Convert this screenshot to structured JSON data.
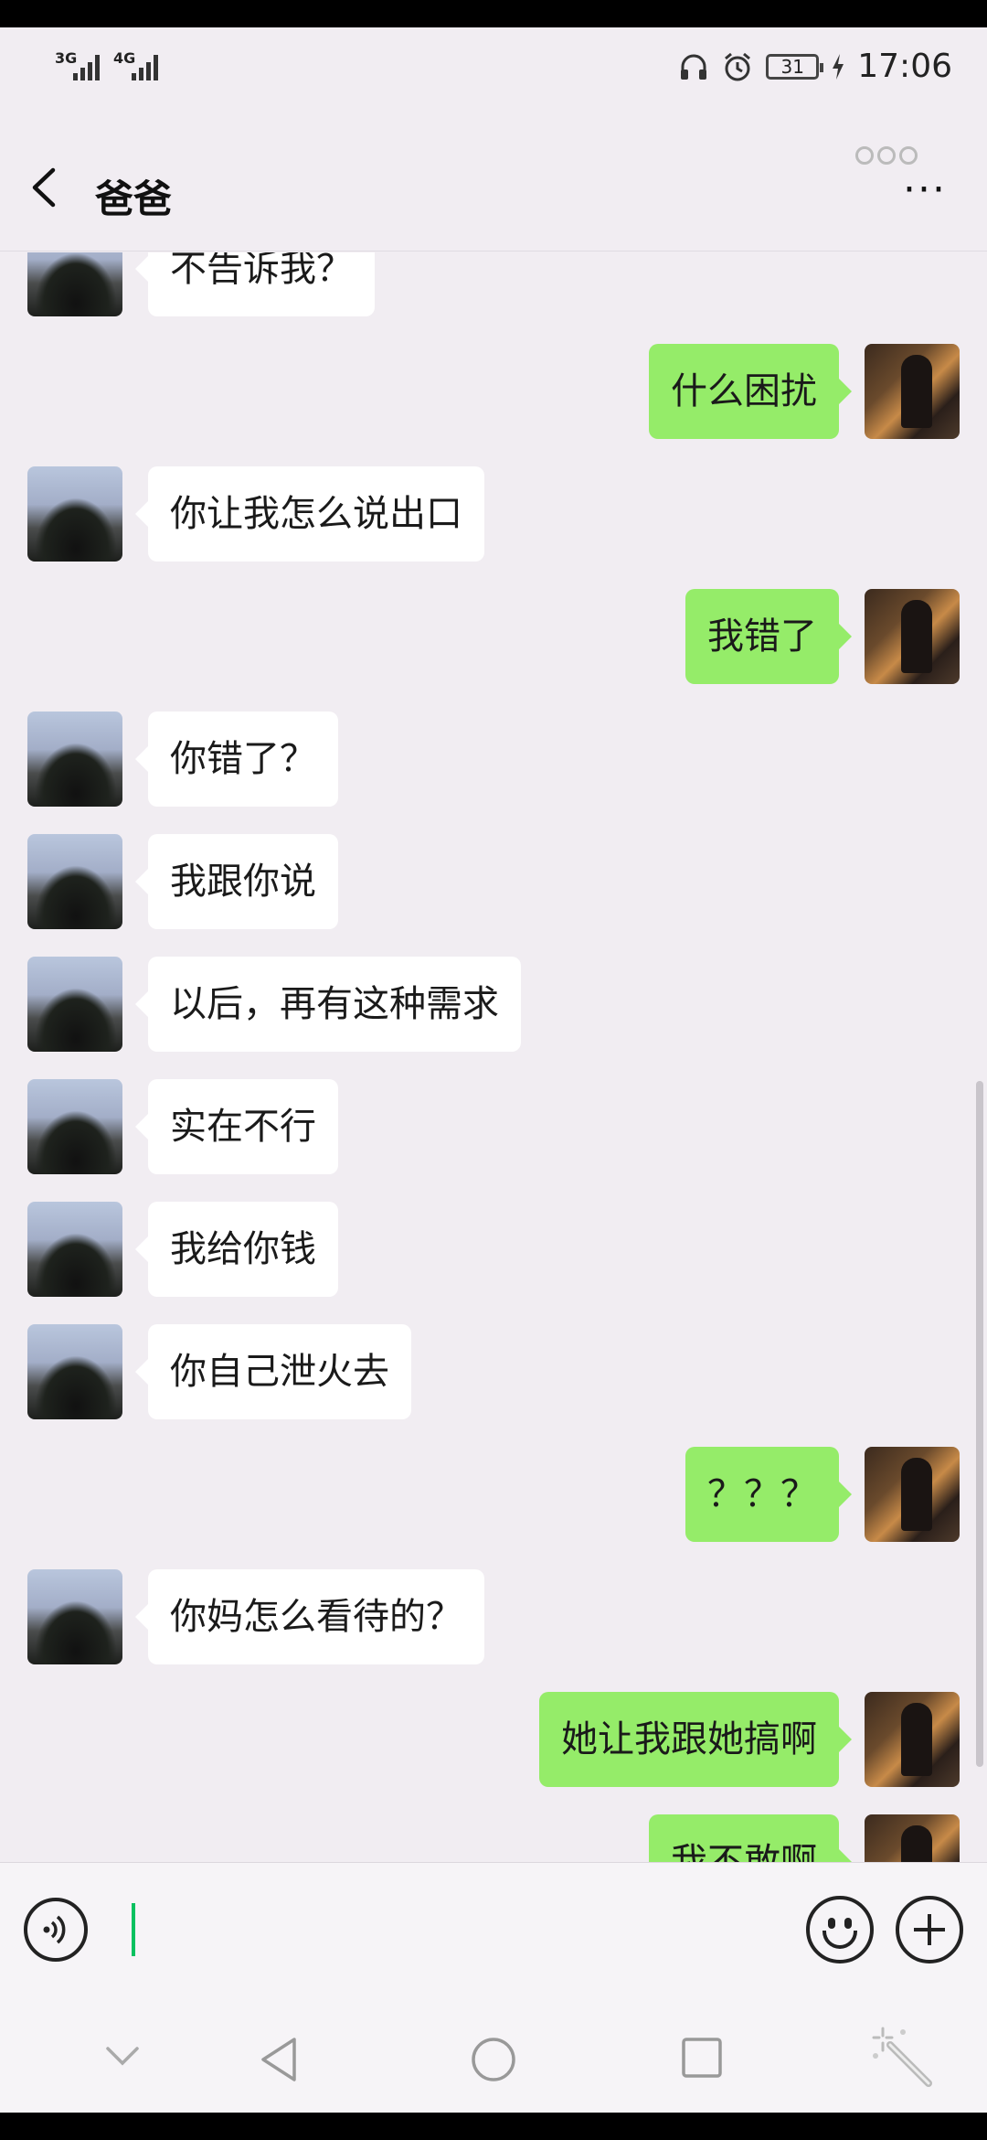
{
  "status_bar": {
    "signal_1": "3G",
    "signal_2": "4G",
    "battery": "31",
    "time": "17:06"
  },
  "header": {
    "title": "爸爸",
    "more": "···"
  },
  "messages": [
    {
      "side": "left",
      "text": "不告诉我？"
    },
    {
      "side": "right",
      "text": "什么困扰"
    },
    {
      "side": "left",
      "text": "你让我怎么说出口"
    },
    {
      "side": "right",
      "text": "我错了"
    },
    {
      "side": "left",
      "text": "你错了？"
    },
    {
      "side": "left",
      "text": "我跟你说"
    },
    {
      "side": "left",
      "text": "以后，再有这种需求"
    },
    {
      "side": "left",
      "text": "实在不行"
    },
    {
      "side": "left",
      "text": "我给你钱"
    },
    {
      "side": "left",
      "text": "你自己泄火去"
    },
    {
      "side": "right",
      "text": "？？？"
    },
    {
      "side": "left",
      "text": "你妈怎么看待的？"
    },
    {
      "side": "right",
      "text": "她让我跟她搞啊"
    },
    {
      "side": "right",
      "text": "我不敢啊"
    }
  ],
  "colors": {
    "sent_bubble": "#95ec69",
    "received_bubble": "#ffffff",
    "background": "#f1edf2",
    "caret": "#07c160"
  },
  "icons": {
    "back": "chevron-left-icon",
    "more": "more-dots-icon",
    "voice": "voice-icon",
    "emoji": "emoji-icon",
    "plus": "plus-icon",
    "nav_down": "nav-down-icon",
    "nav_back": "nav-back-icon",
    "nav_home": "nav-home-icon",
    "nav_recent": "nav-recent-icon",
    "magic": "magic-wand-icon"
  }
}
